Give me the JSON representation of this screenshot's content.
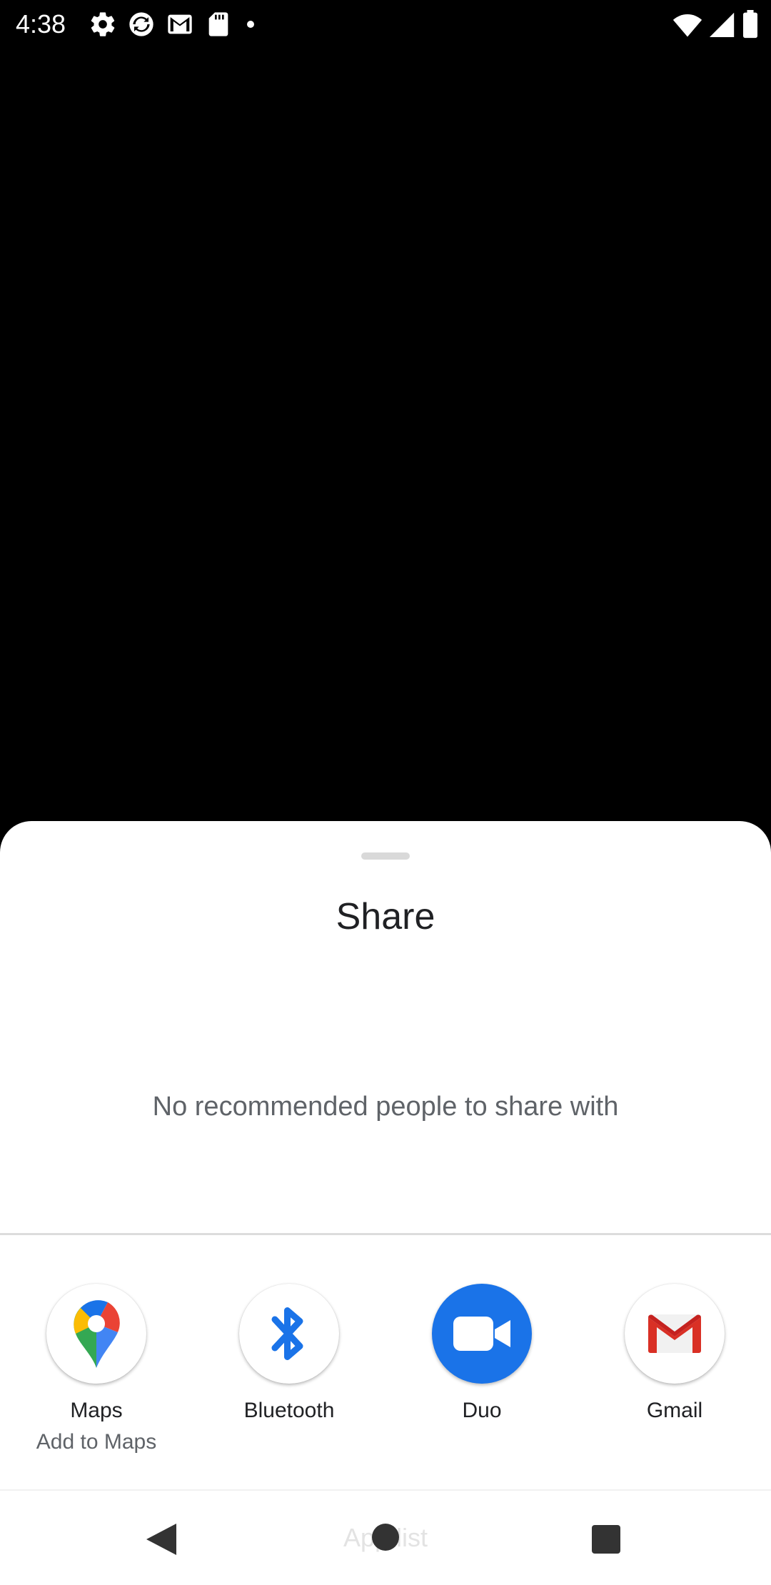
{
  "status_bar": {
    "time": "4:38",
    "left_icons": [
      "settings-icon",
      "sync-icon",
      "gmail-icon",
      "sd-card-icon",
      "notification-dot-icon"
    ],
    "right_icons": [
      "wifi-icon",
      "signal-icon",
      "battery-icon"
    ]
  },
  "share_sheet": {
    "title": "Share",
    "empty_message": "No recommended people to share with",
    "targets": [
      {
        "label": "Maps",
        "sublabel": "Add to Maps",
        "icon": "maps-icon"
      },
      {
        "label": "Bluetooth",
        "sublabel": "",
        "icon": "bluetooth-icon"
      },
      {
        "label": "Duo",
        "sublabel": "",
        "icon": "duo-icon"
      },
      {
        "label": "Gmail",
        "sublabel": "",
        "icon": "gmail-icon"
      }
    ]
  },
  "nav_bar": {
    "hint_text": "App list",
    "buttons": [
      "back-icon",
      "home-icon",
      "recents-icon"
    ]
  },
  "colors": {
    "duo_blue": "#1a73e8",
    "bluetooth_blue": "#1a73e8",
    "gmail_red": "#d93025",
    "text_primary": "#202124",
    "text_secondary": "#5f6368"
  }
}
